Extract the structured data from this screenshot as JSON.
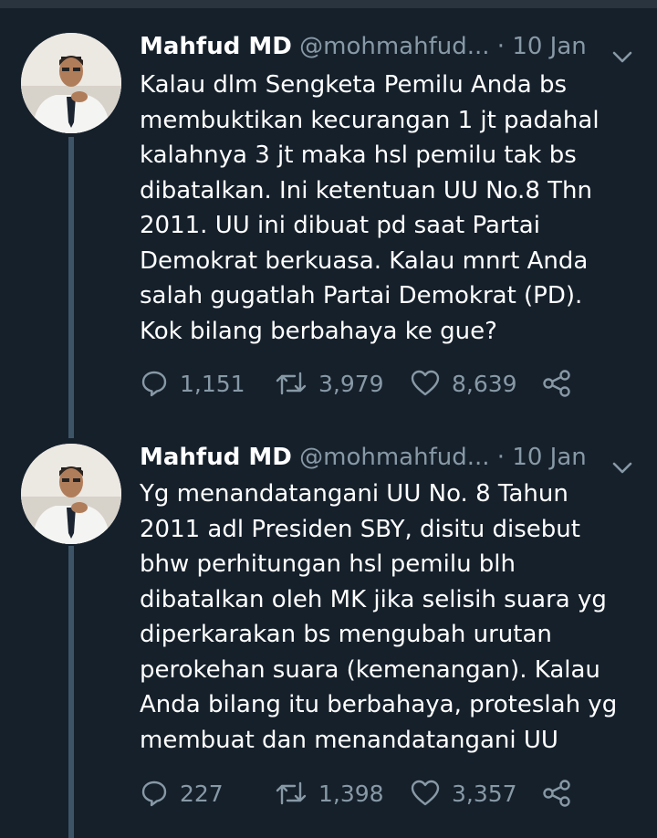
{
  "tweets": [
    {
      "author_name": "Mahfud MD",
      "handle": "@mohmahfud...",
      "separator": "·",
      "date": "10 Jan",
      "text": "Kalau dlm Sengketa Pemilu Anda bs\nmembuktikan kecurangan 1 jt padahal\nkalahnya 3 jt maka hsl pemilu tak bs\ndibatalkan. Ini ketentuan UU No.8 Thn\n2011. UU ini dibuat pd saat Partai\nDemokrat berkuasa. Kalau mnrt Anda\nsalah gugatlah Partai Demokrat (PD).\nKok bilang berbahaya ke gue?",
      "replies": "1,151",
      "retweets": "3,979",
      "likes": "8,639"
    },
    {
      "author_name": "Mahfud MD",
      "handle": "@mohmahfud...",
      "separator": "·",
      "date": "10 Jan",
      "text": "Yg menandatangani UU No. 8 Tahun\n2011 adl Presiden SBY, disitu disebut\nbhw perhitungan hsl pemilu blh\ndibatalkan oleh MK jika selisih suara yg\ndiperkarakan bs mengubah urutan\nperokehan suara (kemenangan). Kalau\nAnda bilang itu berbahaya, proteslah yg\nmembuat dan menandatangani UU",
      "replies": "227",
      "retweets": "1,398",
      "likes": "3,357"
    }
  ],
  "colors": {
    "background": "#15202b",
    "secondary_text": "#8899a6",
    "thread_line": "#3d5466"
  },
  "icons": [
    "reply-icon",
    "retweet-icon",
    "like-icon",
    "share-icon",
    "chevron-down-icon"
  ]
}
